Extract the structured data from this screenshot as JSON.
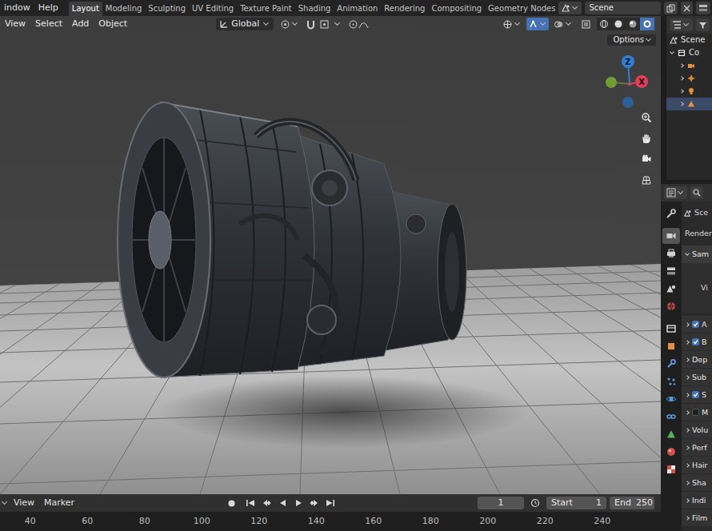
{
  "top_bar": {
    "menu": [
      "indow",
      "Help"
    ],
    "workspaces": [
      {
        "label": "Layout",
        "selected": true
      },
      {
        "label": "Modeling",
        "selected": false
      },
      {
        "label": "Sculpting",
        "selected": false
      },
      {
        "label": "UV Editing",
        "selected": false
      },
      {
        "label": "Texture Paint",
        "selected": false
      },
      {
        "label": "Shading",
        "selected": false
      },
      {
        "label": "Animation",
        "selected": false
      },
      {
        "label": "Rendering",
        "selected": false
      },
      {
        "label": "Compositing",
        "selected": false
      },
      {
        "label": "Geometry Nodes",
        "selected": false
      }
    ],
    "scene": "Scene"
  },
  "viewport": {
    "menu": [
      "View",
      "Select",
      "Add",
      "Object"
    ],
    "orientation": "Global",
    "toggles": [
      {
        "kind": "visibility",
        "on": false
      },
      {
        "kind": "gizmo",
        "on": true
      },
      {
        "kind": "overlay",
        "on": false
      },
      {
        "kind": "xray",
        "on": false
      }
    ],
    "shading": [
      {
        "kind": "wireframe",
        "selected": false
      },
      {
        "kind": "solid",
        "selected": false
      },
      {
        "kind": "material",
        "selected": false
      },
      {
        "kind": "rendered",
        "selected": true
      }
    ],
    "options": "Options",
    "gizmo": {
      "z": "Z",
      "x": "X"
    }
  },
  "outliner": {
    "scene": "Scene",
    "collection": {
      "label": "Co",
      "expanded": true
    },
    "objects": [
      {
        "kind": "camera",
        "expanded": false,
        "selected": false
      },
      {
        "kind": "empty",
        "expanded": false,
        "selected": false
      },
      {
        "kind": "light",
        "expanded": false,
        "selected": false
      },
      {
        "kind": "mesh",
        "expanded": false,
        "selected": true
      }
    ]
  },
  "properties": {
    "tabs": [
      {
        "kind": "tool",
        "selected": false
      },
      {
        "kind": "render",
        "selected": true
      },
      {
        "kind": "output",
        "selected": false
      },
      {
        "kind": "view_layer",
        "selected": false
      },
      {
        "kind": "scene",
        "selected": false
      },
      {
        "kind": "world",
        "selected": false
      },
      {
        "kind": "collection",
        "selected": false
      },
      {
        "kind": "object",
        "selected": false
      },
      {
        "kind": "modifiers",
        "selected": false
      },
      {
        "kind": "particles",
        "selected": false
      },
      {
        "kind": "physics",
        "selected": false
      },
      {
        "kind": "constraints",
        "selected": false
      },
      {
        "kind": "data",
        "selected": false
      },
      {
        "kind": "material",
        "selected": false
      },
      {
        "kind": "texture",
        "selected": false
      }
    ],
    "context": "Sce",
    "panel": "Render",
    "sampling": {
      "label": "Sam",
      "expanded": true,
      "sub": "Vi"
    },
    "sections": [
      {
        "label": "A",
        "kind": "toggle",
        "checked": true,
        "expanded": false
      },
      {
        "label": "B",
        "kind": "toggle",
        "checked": true,
        "expanded": false
      },
      {
        "label": "Dep",
        "kind": "plain",
        "expanded": false
      },
      {
        "label": "Sub",
        "kind": "plain",
        "expanded": false
      },
      {
        "label": "S",
        "kind": "toggle",
        "checked": true,
        "expanded": false
      },
      {
        "label": "M",
        "kind": "toggle",
        "checked": false,
        "expanded": false
      },
      {
        "label": "Volu",
        "kind": "plain",
        "expanded": false
      },
      {
        "label": "Perf",
        "kind": "plain",
        "expanded": false
      },
      {
        "label": "Hair",
        "kind": "plain",
        "expanded": false
      },
      {
        "label": "Sha",
        "kind": "plain",
        "expanded": false
      },
      {
        "label": "Indi",
        "kind": "plain",
        "expanded": false
      },
      {
        "label": "Film",
        "kind": "plain",
        "expanded": false
      }
    ]
  },
  "timeline": {
    "menu": [
      "View",
      "Marker"
    ],
    "frame": "1",
    "start": {
      "label": "Start",
      "value": "1"
    },
    "end": {
      "label": "End",
      "value": "250"
    },
    "ruler": [
      "40",
      "60",
      "80",
      "100",
      "120",
      "140",
      "160",
      "180",
      "200",
      "220",
      "240"
    ]
  }
}
